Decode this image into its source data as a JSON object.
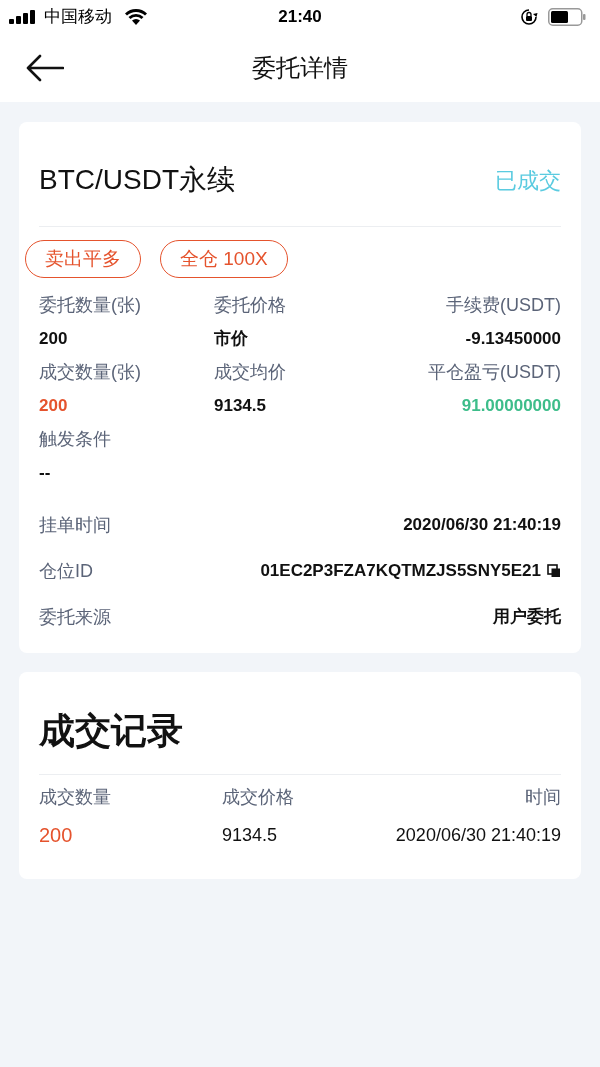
{
  "status_bar": {
    "carrier": "中国移动",
    "time": "21:40"
  },
  "header": {
    "title": "委托详情"
  },
  "order": {
    "pair": "BTC/USDT永续",
    "status": "已成交",
    "tags": [
      "卖出平多",
      "全仓 100X"
    ],
    "fields": [
      {
        "label": "委托数量(张)",
        "value": "200",
        "kind": "plain"
      },
      {
        "label": "委托价格",
        "value": "市价",
        "kind": "plain"
      },
      {
        "label": "手续费(USDT)",
        "value": "-9.13450000",
        "kind": "plain"
      },
      {
        "label": "成交数量(张)",
        "value": "200",
        "kind": "sell"
      },
      {
        "label": "成交均价",
        "value": "9134.5",
        "kind": "plain"
      },
      {
        "label": "平仓盈亏(USDT)",
        "value": "91.00000000",
        "kind": "profit"
      },
      {
        "label": "触发条件",
        "value": "--",
        "kind": "plain"
      }
    ],
    "details": [
      {
        "label": "挂单时间",
        "value": "2020/06/30 21:40:19",
        "copyable": false
      },
      {
        "label": "仓位ID",
        "value": "01EC2P3FZA7KQTMZJS5SNY5E21",
        "copyable": true
      },
      {
        "label": "委托来源",
        "value": "用户委托",
        "copyable": false
      }
    ]
  },
  "trades": {
    "title": "成交记录",
    "columns": [
      "成交数量",
      "成交价格",
      "时间"
    ],
    "rows": [
      {
        "cells": [
          "200",
          "9134.5",
          "2020/06/30 21:40:19"
        ]
      }
    ]
  }
}
